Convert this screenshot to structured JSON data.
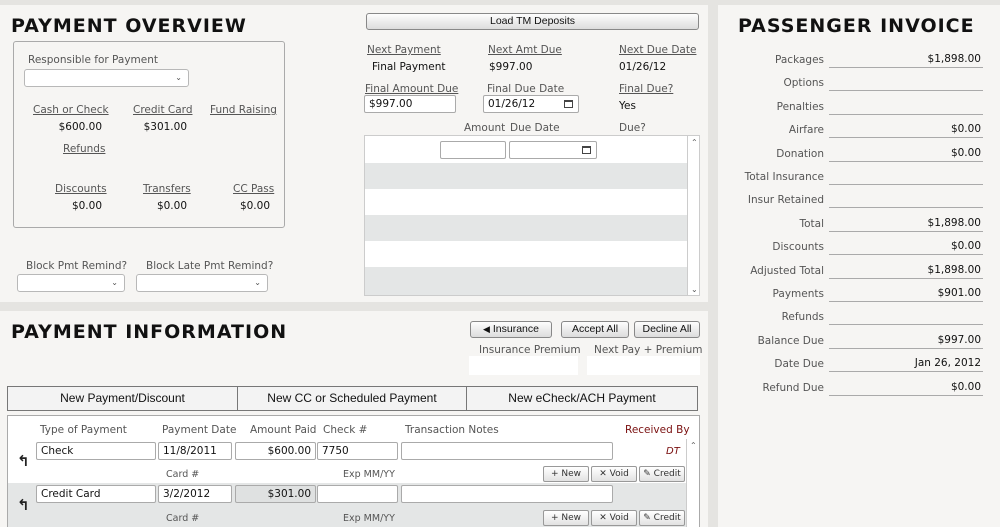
{
  "payment_overview": {
    "title": "PAYMENT OVERVIEW",
    "responsible_label": "Responsible for Payment",
    "responsible_value": "",
    "cash_label": "Cash or Check",
    "cash_value": "$600.00",
    "credit_label": "Credit Card",
    "credit_value": "$301.00",
    "fund_label": "Fund Raising",
    "fund_value": "",
    "refunds_label": "Refunds",
    "discounts_label": "Discounts",
    "discounts_value": "$0.00",
    "transfers_label": "Transfers",
    "transfers_value": "$0.00",
    "ccpass_label": "CC Pass",
    "ccpass_value": "$0.00",
    "block_pmt_label": "Block Pmt Remind?",
    "block_late_label": "Block Late Pmt Remind?",
    "load_button": "Load TM Deposits",
    "next_payment_label": "Next Payment",
    "next_payment_value": "Final Payment",
    "next_amt_label": "Next Amt Due",
    "next_amt_value": "$997.00",
    "next_due_label": "Next Due Date",
    "next_due_value": "01/26/12",
    "final_amount_label": "Final Amount Due",
    "final_amount_value": "$997.00",
    "final_due_date_label": "Final Due Date",
    "final_due_date_value": "01/26/12",
    "final_due_q_label": "Final Due?",
    "final_due_q_value": "Yes",
    "sched_amount_label": "Amount",
    "sched_due_date_label": "Due Date",
    "sched_due_label": "Due?"
  },
  "payment_information": {
    "title": "PAYMENT INFORMATION",
    "insurance_button": "Insurance",
    "accept_all_button": "Accept All",
    "decline_all_button": "Decline All",
    "insurance_premium_label": "Insurance Premium",
    "next_pay_premium_label": "Next Pay + Premium",
    "tabs": [
      "New Payment/Discount",
      "New CC or Scheduled Payment",
      "New eCheck/ACH Payment"
    ],
    "columns": {
      "type": "Type of Payment",
      "date": "Payment Date",
      "amount": "Amount Paid",
      "check": "Check #",
      "notes": "Transaction Notes",
      "received": "Received By"
    },
    "card_label": "Card #",
    "exp_label": "Exp MM/YY",
    "new_label": "New",
    "void_label": "Void",
    "credit_label": "Credit",
    "rows": [
      {
        "type": "Check",
        "date": "11/8/2011",
        "amount": "$600.00",
        "check": "7750",
        "notes": "",
        "received": "DT"
      },
      {
        "type": "Credit Card",
        "date": "3/2/2012",
        "amount": "$301.00",
        "check": "",
        "notes": "",
        "received": ""
      }
    ]
  },
  "invoice": {
    "title": "PASSENGER INVOICE",
    "lines": [
      {
        "label": "Packages",
        "value": "$1,898.00"
      },
      {
        "label": "Options",
        "value": ""
      },
      {
        "label": "Penalties",
        "value": ""
      },
      {
        "label": "Airfare",
        "value": "$0.00"
      },
      {
        "label": "Donation",
        "value": "$0.00"
      },
      {
        "label": "Total Insurance",
        "value": ""
      },
      {
        "label": "Insur Retained",
        "value": ""
      },
      {
        "label": "Total",
        "value": "$1,898.00"
      },
      {
        "label": "Discounts",
        "value": "$0.00"
      },
      {
        "label": "Adjusted Total",
        "value": "$1,898.00"
      },
      {
        "label": "Payments",
        "value": "$901.00"
      },
      {
        "label": "Refunds",
        "value": ""
      },
      {
        "label": "Balance Due",
        "value": "$997.00"
      },
      {
        "label": "Date Due",
        "value": "Jan 26, 2012"
      },
      {
        "label": "Refund Due",
        "value": "$0.00"
      }
    ]
  }
}
